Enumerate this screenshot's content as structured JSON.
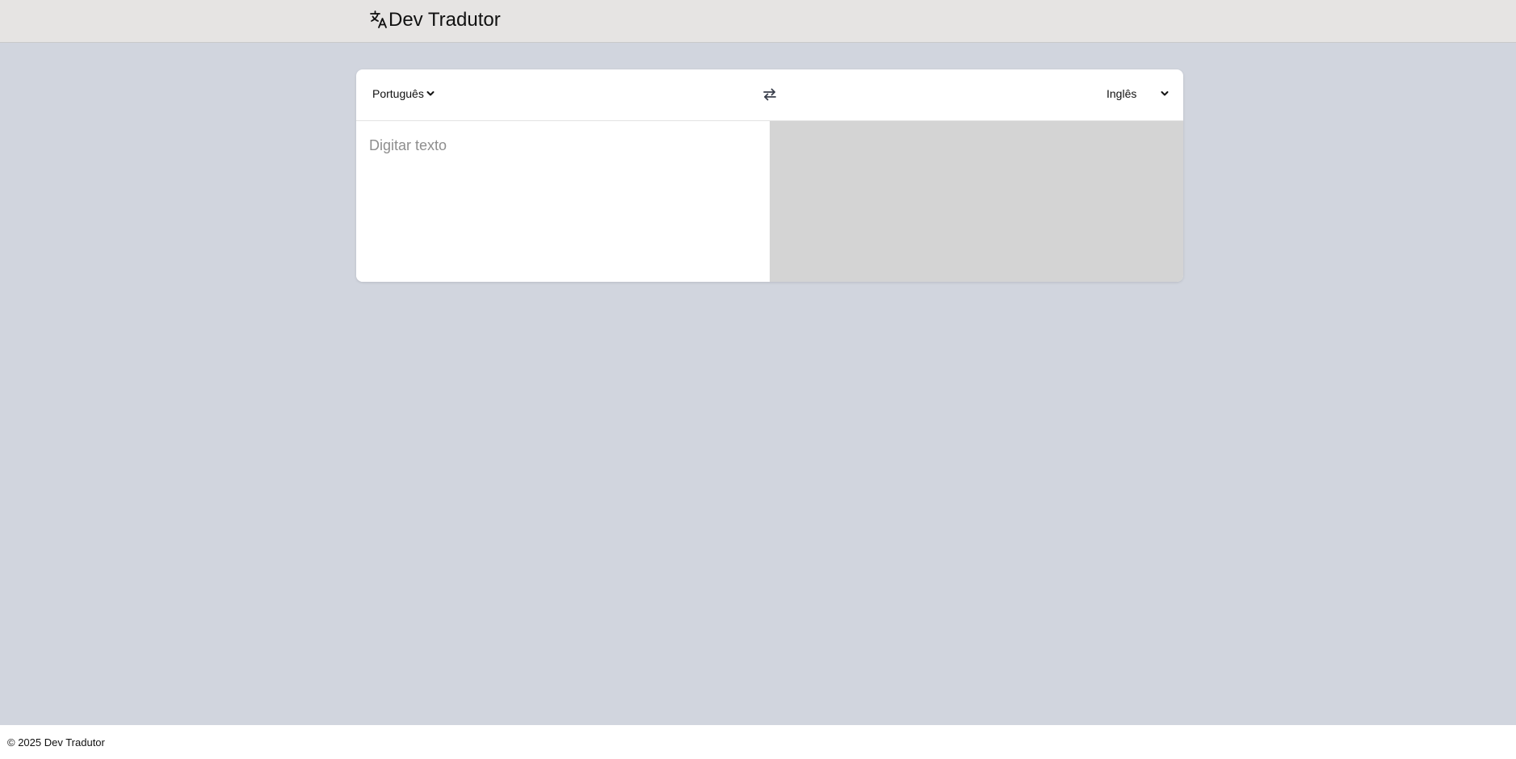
{
  "header": {
    "title": "Dev Tradutor",
    "logo_icon": "translate-icon"
  },
  "translator": {
    "source_language": "Português",
    "target_language": "Inglês",
    "swap_icon": "swap-arrows-icon",
    "input_placeholder": "Digitar texto",
    "input_value": "",
    "output_text": ""
  },
  "footer": {
    "copyright": "© 2025 Dev Tradutor"
  },
  "colors": {
    "page_background": "#d1d5de",
    "header_background": "#e6e4e3",
    "card_background": "#ffffff",
    "output_background": "#d4d4d4"
  }
}
